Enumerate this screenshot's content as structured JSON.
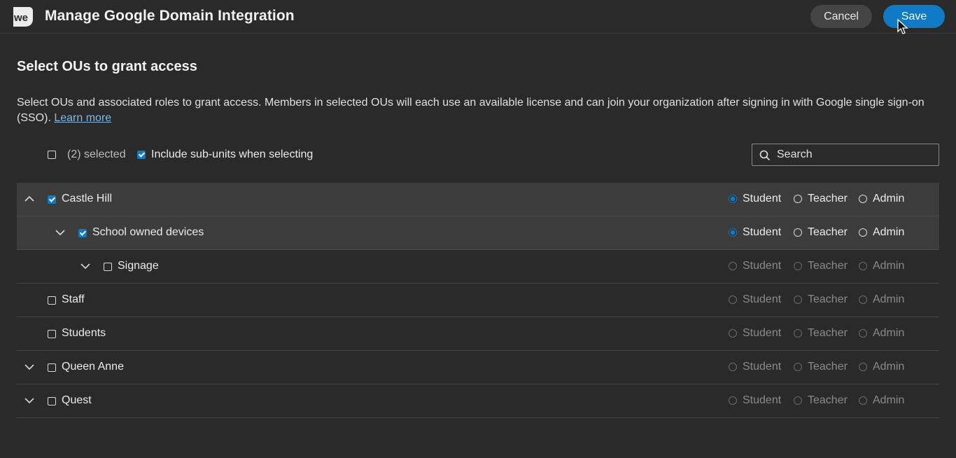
{
  "header": {
    "title": "Manage Google Domain Integration",
    "cancel_label": "Cancel",
    "save_label": "Save",
    "logo_text": "we"
  },
  "section": {
    "title": "Select OUs to grant access",
    "description": "Select OUs and associated roles to grant access. Members in selected OUs will each use an available license and can join your organization after signing in with Google single sign-on (SSO).",
    "learn_more": "Learn more"
  },
  "toolbar": {
    "selected_count": "(2) selected",
    "include_subunits_label": "Include sub-units when selecting",
    "include_subunits_checked": true,
    "search_placeholder": "Search"
  },
  "roles": [
    "Student",
    "Teacher",
    "Admin"
  ],
  "rows": [
    {
      "label": "Castle Hill",
      "checked": true,
      "expanded": true,
      "role": "Student"
    },
    {
      "label": "School owned devices",
      "checked": true,
      "expanded": false,
      "role": "Student"
    },
    {
      "label": "Signage",
      "checked": false,
      "expanded": false,
      "role": null
    },
    {
      "label": "Staff",
      "checked": false,
      "role": null
    },
    {
      "label": "Students",
      "checked": false,
      "role": null
    },
    {
      "label": "Queen Anne",
      "checked": false,
      "expanded": false,
      "role": null
    },
    {
      "label": "Quest",
      "checked": false,
      "expanded": false,
      "role": null
    }
  ],
  "colors": {
    "accent": "#0f7ac6",
    "background": "#2a2a2a",
    "selected_row": "#3c3c3c"
  }
}
